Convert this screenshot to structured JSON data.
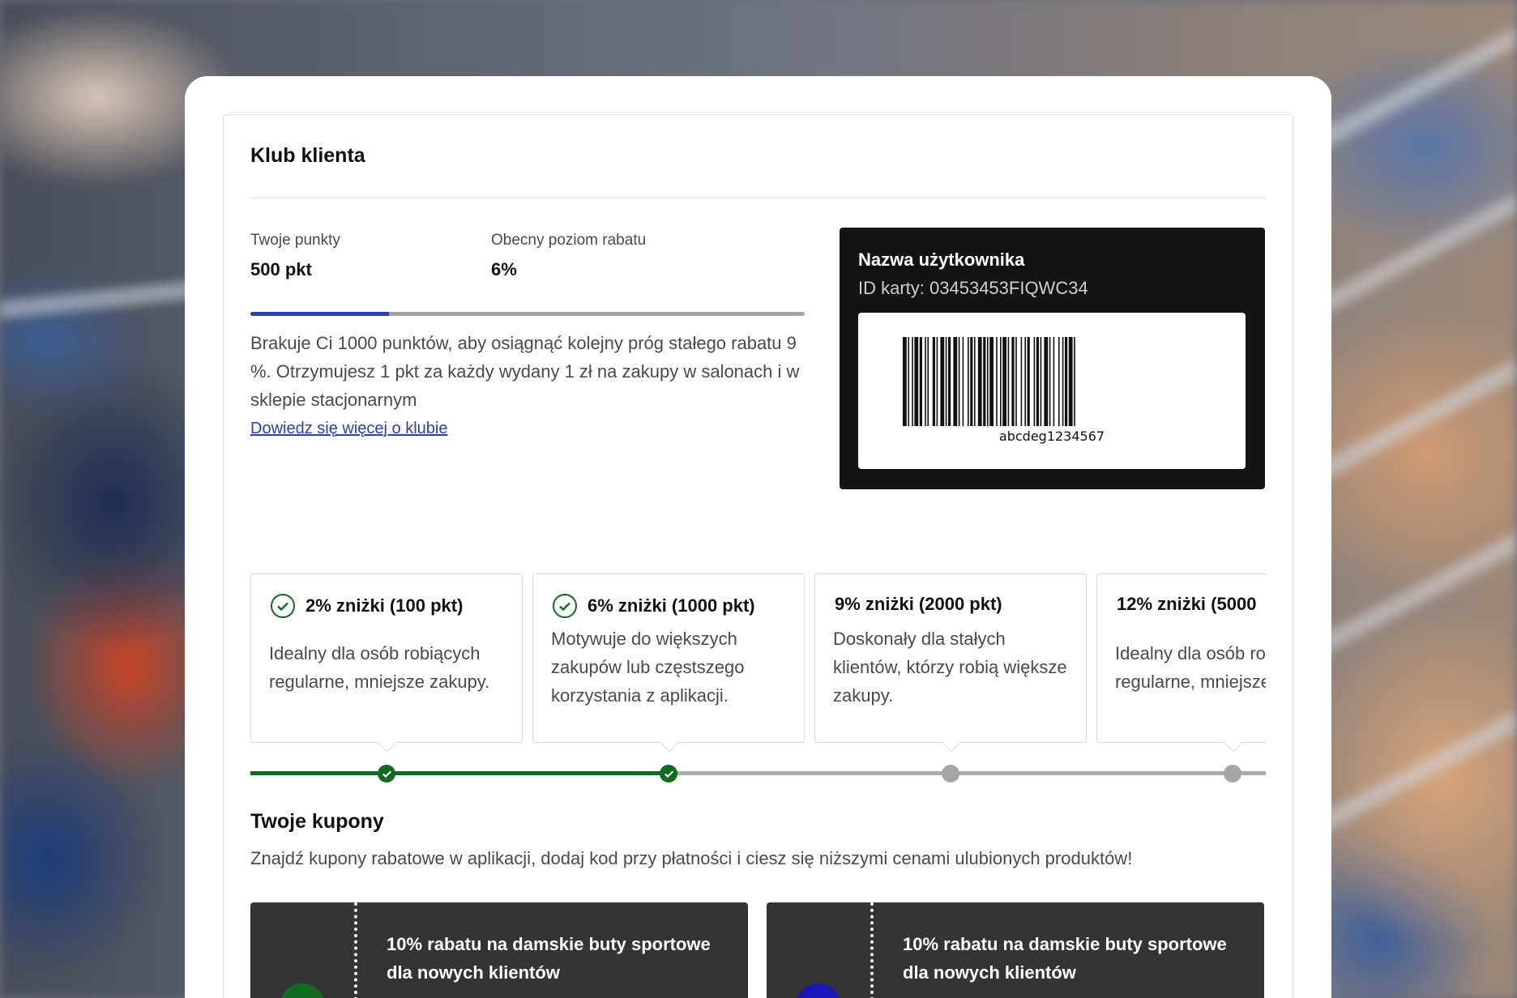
{
  "club": {
    "title": "Klub klienta",
    "points_label": "Twoje punkty",
    "points_value": "500 pkt",
    "discount_label": "Obecny poziom rabatu",
    "discount_value": "6%",
    "progress_fraction": 0.25,
    "info_text": "Brakuje Ci 1000 punktów, aby osiągnąć kolejny próg stałego rabatu 9 %. Otrzymujesz 1 pkt za każdy wydany 1 zł na zakupy w salonach i w sklepie stacjonarnym",
    "link_label": "Dowiedz się więcej o klubie"
  },
  "member_card": {
    "name": "Nazwa użytkownika",
    "card_id": "ID karty: 03453453FIQWC34",
    "barcode_text": "abcdeg1234567"
  },
  "tiers": [
    {
      "title": "2% zniżki (100 pkt)",
      "desc": "Idealny dla osób robiących regularne, mniejsze zakupy.",
      "achieved": true,
      "icon": "check-circle-icon"
    },
    {
      "title": "6% zniżki (1000 pkt)",
      "desc": "Motywuje do większych zakupów lub częstszego korzystania z aplikacji.",
      "achieved": true,
      "icon": "check-circle-icon"
    },
    {
      "title": "9% zniżki (2000 pkt)",
      "desc": "Doskonały dla stałych klientów, którzy robią większe zakupy.",
      "achieved": false
    },
    {
      "title": "12% zniżki  (5000",
      "desc": "Idealny dla osób robiących regularne, mniejsze zakupy.",
      "achieved": false
    }
  ],
  "coupons": {
    "title": "Twoje kupony",
    "subtitle": "Znajdź kupony rabatowe w aplikacji, dodaj kod przy płatności i ciesz się niższymi cenami ulubionych produktów!",
    "items": [
      {
        "text": "10% rabatu na damskie buty sportowe dla nowych klientów",
        "badge_color": "#0e6b1f"
      },
      {
        "text": "10% rabatu na damskie buty sportowe dla nowych klientów",
        "badge_color": "#1a16b8"
      }
    ]
  },
  "colors": {
    "accent_blue": "#2b3fa6",
    "success_green": "#0e6b1f",
    "card_black": "#141414",
    "coupon_dark": "#343434"
  }
}
